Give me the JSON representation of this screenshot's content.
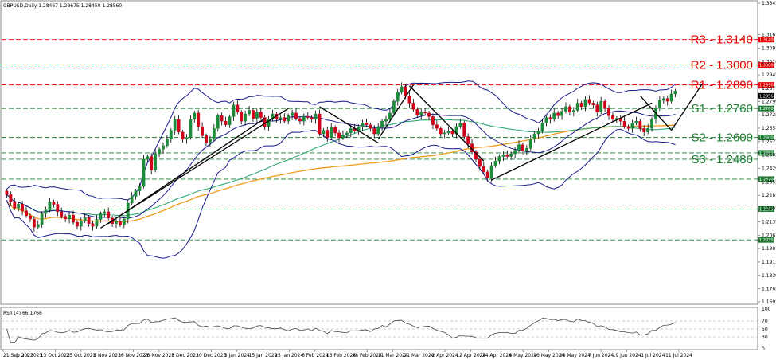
{
  "chart_data": {
    "type": "candlestick",
    "title": "GBPUSD,Daily  1.28467 1.28675 1.28450 1.28560",
    "symbol": "GBPUSD",
    "timeframe": "Daily",
    "ylim": [
      1.1693,
      1.3341
    ],
    "price_ticks": [
      "1.33410",
      "1.31670",
      "1.30930",
      "1.30180",
      "1.29450",
      "1.28710",
      "1.27990",
      "1.27250",
      "1.26510",
      "1.25770",
      "1.25030",
      "1.24290",
      "1.23550",
      "1.22810",
      "1.22070",
      "1.21350",
      "1.20610",
      "1.19870",
      "1.19130",
      "1.18390",
      "1.17650",
      "1.16930"
    ],
    "x_labels": [
      "21 Sep 2023",
      "3 Oct 2023",
      "13 Oct 2023",
      "25 Oct 2023",
      "6 Nov 2023",
      "16 Nov 2023",
      "28 Nov 2023",
      "8 Dec 2023",
      "20 Dec 2023",
      "3 Jan 2024",
      "15 Jan 2024",
      "25 Jan 2024",
      "6 Feb 2024",
      "16 Feb 2024",
      "28 Feb 2024",
      "11 Mar 2024",
      "21 Mar 2024",
      "2 Apr 2024",
      "12 Apr 2024",
      "24 Apr 2024",
      "6 May 2024",
      "16 May 2024",
      "28 May 2024",
      "7 Jun 2024",
      "19 Jun 2024",
      "1 Jul 2024",
      "11 Jul 2024"
    ],
    "levels": [
      {
        "name": "R3",
        "value": 1.314,
        "label": "R3 - 1.3140",
        "tag": "1.31400",
        "color": "#e60000"
      },
      {
        "name": "R2",
        "value": 1.3,
        "label": "R2 - 1.3000",
        "tag": "1.30000",
        "color": "#e60000"
      },
      {
        "name": "R1",
        "value": 1.289,
        "label": "R1 - 1.2890",
        "tag": "1.28900",
        "color": "#e60000"
      },
      {
        "name": "S1",
        "value": 1.276,
        "label": "S1 - 1.2760",
        "tag": "1.27600",
        "color": "#1e7d32"
      },
      {
        "name": "S2",
        "value": 1.26,
        "label": "S2 - 1.2600",
        "tag": "1.26000",
        "color": "#1e7d32"
      },
      {
        "name": "",
        "value": 1.2515,
        "label": "",
        "tag": "1.24800",
        "color": "#1e7d32"
      },
      {
        "name": "S3",
        "value": 1.248,
        "label": "S3 - 1.2480",
        "tag": "",
        "color": "#1e7d32"
      },
      {
        "name": "",
        "value": 1.237,
        "label": "",
        "tag": "1.23700",
        "color": "#1e7d32"
      },
      {
        "name": "",
        "value": 1.2205,
        "label": "",
        "tag": "1.22050",
        "color": "#1e7d32"
      },
      {
        "name": "",
        "value": 1.2035,
        "label": "",
        "tag": "1.20350",
        "color": "#1e7d32"
      }
    ],
    "current_price_tag": "1.28560",
    "closes": [
      1.2285,
      1.2245,
      1.221,
      1.2232,
      1.2195,
      1.2168,
      1.215,
      1.2105,
      1.212,
      1.218,
      1.22,
      1.2245,
      1.2231,
      1.219,
      1.2165,
      1.215,
      1.2171,
      1.2132,
      1.211,
      1.214,
      1.2158,
      1.2125,
      1.211,
      1.2148,
      1.218,
      1.219,
      1.2155,
      1.2125,
      1.2135,
      1.2118,
      1.215,
      1.2238,
      1.2275,
      1.2305,
      1.233,
      1.248,
      1.2495,
      1.242,
      1.251,
      1.2535,
      1.2555,
      1.259,
      1.264,
      1.27,
      1.263,
      1.259,
      1.26,
      1.27,
      1.2735,
      1.266,
      1.261,
      1.257,
      1.259,
      1.265,
      1.272,
      1.269,
      1.267,
      1.2715,
      1.278,
      1.274,
      1.269,
      1.273,
      1.275,
      1.2705,
      1.274,
      1.271,
      1.266,
      1.27,
      1.273,
      1.27,
      1.271,
      1.269,
      1.272,
      1.2735,
      1.2705,
      1.269,
      1.2715,
      1.271,
      1.27,
      1.273,
      1.262,
      1.264,
      1.26,
      1.2655,
      1.2625,
      1.2598,
      1.2615,
      1.2625,
      1.265,
      1.2635,
      1.266,
      1.268,
      1.267,
      1.265,
      1.262,
      1.2655,
      1.269,
      1.27,
      1.2735,
      1.28,
      1.285,
      1.288,
      1.283,
      1.279,
      1.2755,
      1.2725,
      1.274,
      1.2735,
      1.2715,
      1.267,
      1.265,
      1.262,
      1.2625,
      1.2635,
      1.262,
      1.266,
      1.268,
      1.2605,
      1.2565,
      1.252,
      1.248,
      1.244,
      1.241,
      1.2375,
      1.2445,
      1.247,
      1.2495,
      1.2505,
      1.2495,
      1.251,
      1.253,
      1.256,
      1.2525,
      1.254,
      1.259,
      1.262,
      1.2635,
      1.268,
      1.271,
      1.27,
      1.2735,
      1.272,
      1.2745,
      1.277,
      1.274,
      1.275,
      1.279,
      1.277,
      1.281,
      1.279,
      1.278,
      1.274,
      1.28,
      1.276,
      1.272,
      1.27,
      1.2705,
      1.269,
      1.266,
      1.265,
      1.268,
      1.269,
      1.265,
      1.263,
      1.265,
      1.27,
      1.276,
      1.2805,
      1.2815,
      1.28,
      1.284,
      1.2856
    ],
    "series": [
      {
        "name": "Bollinger Bands",
        "color": "#1a1a8c"
      },
      {
        "name": "MA 100",
        "color": "#2eaa72"
      },
      {
        "name": "MA 200",
        "color": "#f29b1a"
      }
    ],
    "rsi": {
      "label": "RSI(14) 66.1766",
      "value": 66.1766,
      "ylim": [
        0,
        100
      ],
      "ticks": [
        "100",
        "70",
        "50",
        "30",
        "0"
      ]
    }
  }
}
